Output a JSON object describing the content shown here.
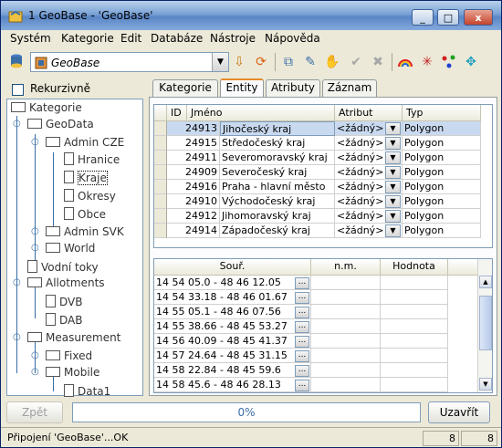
{
  "window": {
    "title": "1 GeoBase - 'GeoBase'",
    "buttons": {
      "minimize": "_",
      "maximize": "□",
      "close": "x"
    }
  },
  "menu": [
    "Systém",
    "Kategorie",
    "Edit",
    "Databáze",
    "Nástroje",
    "Nápověda"
  ],
  "toolbar": {
    "database_value": "GeoBase",
    "icons": [
      "database-icon",
      "import-icon",
      "refresh-icon",
      "copy-icon",
      "edit-icon",
      "hand-icon",
      "confirm-icon",
      "cancel-icon",
      "rainbow-icon",
      "star-icon",
      "nodes-icon",
      "puzzle-icon"
    ]
  },
  "left": {
    "recursive_label": "Rekurzivně",
    "tree": [
      {
        "label": "Kategorie"
      },
      {
        "label": "GeoData"
      },
      {
        "label": "Admin CZE"
      },
      {
        "label": "Hranice"
      },
      {
        "label": "Kraje"
      },
      {
        "label": "Okresy"
      },
      {
        "label": "Obce"
      },
      {
        "label": "Admin SVK"
      },
      {
        "label": "World"
      },
      {
        "label": "Vodní toky"
      },
      {
        "label": "Allotments"
      },
      {
        "label": "DVB"
      },
      {
        "label": "DAB"
      },
      {
        "label": "Measurement"
      },
      {
        "label": "Fixed"
      },
      {
        "label": "Mobile"
      },
      {
        "label": "Data1"
      }
    ]
  },
  "tabs": [
    "Kategorie",
    "Entity",
    "Atributy",
    "Záznam"
  ],
  "entities": {
    "columns": [
      "ID",
      "Jméno",
      "Atribut",
      "Typ"
    ],
    "rows": [
      {
        "id": "24913",
        "name": "Jihočeský kraj",
        "attr": "<žádný>",
        "type": "Polygon"
      },
      {
        "id": "24915",
        "name": "Středočeský kraj",
        "attr": "<žádný>",
        "type": "Polygon"
      },
      {
        "id": "24911",
        "name": "Severomoravský kraj",
        "attr": "<žádný>",
        "type": "Polygon"
      },
      {
        "id": "24909",
        "name": "Severočeský kraj",
        "attr": "<žádný>",
        "type": "Polygon"
      },
      {
        "id": "24916",
        "name": "Praha - hlavní město",
        "attr": "<žádný>",
        "type": "Polygon"
      },
      {
        "id": "24910",
        "name": "Východočeský kraj",
        "attr": "<žádný>",
        "type": "Polygon"
      },
      {
        "id": "24912",
        "name": "Jihomoravský kraj",
        "attr": "<žádný>",
        "type": "Polygon"
      },
      {
        "id": "24914",
        "name": "Západočeský kraj",
        "attr": "<žádný>",
        "type": "Polygon"
      }
    ]
  },
  "coords": {
    "columns": [
      "Souř.",
      "n.m.",
      "Hodnota"
    ],
    "button_label": "...",
    "rows": [
      "14 54 05.0 - 48 46 12.05",
      "14 54 33.18 - 48 46 01.67",
      "14 55 05.1 - 48 46 07.56",
      "14 55 38.66 - 48 45 53.27",
      "14 56 40.09 - 48 45 41.37",
      "14 57 24.64 - 48 45 31.15",
      "14 58 22.84 - 48 45 59.6",
      "14 58 45.6 - 48 46 28.13"
    ]
  },
  "bottom": {
    "back_label": "Zpět",
    "progress_percent": 0,
    "progress_text": "0%",
    "apply_label": "Uzavřít"
  },
  "status": {
    "message": "Připojení 'GeoBase'...OK",
    "count1": "8",
    "count2": "8"
  }
}
